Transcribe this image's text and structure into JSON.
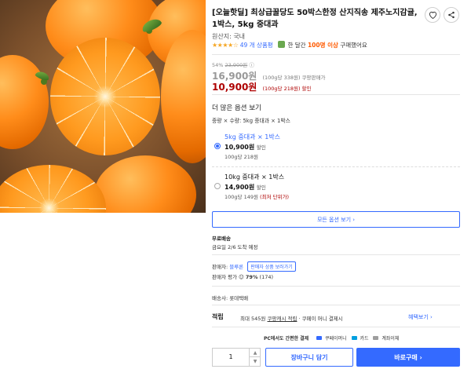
{
  "product": {
    "title": "[오늘핫딜] 최상급꿀당도 50박스한정 산지직송 제주노지감귤, 1박스, 5kg 중대과",
    "origin": "원산지: 국내",
    "rating": {
      "stars": "★★★★☆",
      "review_count": "49 개 상품평",
      "recent_text_prefix": "한 달간",
      "recent_highlight": "100명 이상",
      "recent_text_suffix": "구매했어요"
    }
  },
  "pricing": {
    "discount_rate": "54%",
    "original_price": "23,900원",
    "coupang_price": "16,900원",
    "coupang_unit": "(100g당 338원) 쿠팡판매가",
    "sale_price": "10,900원",
    "sale_unit": "(100g당 218원) 할인"
  },
  "options": {
    "heading": "더 많은 옵션 보기",
    "selected_text": "중량 × 수량: 5kg 중대과 × 1박스",
    "items": [
      {
        "name": "5kg 중대과 × 1박스",
        "price": "10,900원",
        "price_suffix": "할인",
        "unit": "100g당 218원",
        "unit_extra": "",
        "selected": true
      },
      {
        "name": "10kg 중대과 × 1박스",
        "price": "14,900원",
        "price_suffix": "할인",
        "unit": "100g당 149원",
        "unit_extra": "(최저 단위가)",
        "selected": false
      }
    ],
    "all_button": "모든 옵션 보기 ›"
  },
  "shipping": {
    "label": "무료배송",
    "date": "금요일 2/6 도착 예정",
    "company": "배송사: 롯데택배"
  },
  "seller": {
    "label": "판매자:",
    "name": "블루론",
    "more_button": "판매자 상품 보러가기",
    "eval_label": "판매자 평가",
    "eval_percent": "79%",
    "eval_count": "(174)"
  },
  "benefits": {
    "label": "적립",
    "text_prefix": "최대 545원",
    "text_link": "쿠팡캐시 적립",
    "text_suffix": "· 쿠페이 머니 결제시",
    "more": "혜택보기 ›"
  },
  "payment": {
    "heading": "PC에서도 간편한 결제",
    "methods": [
      "쿠페이머니",
      "카드",
      "계좌이체"
    ],
    "colors": [
      "#346aff",
      "#00a0e0",
      "#9e9e9e"
    ]
  },
  "purchase": {
    "quantity": "1",
    "quantity_up": "▲",
    "quantity_down": "▼",
    "cart_button": "장바구니 담기",
    "buy_button": "바로구매 ›"
  },
  "icons": {
    "heart": "heart-icon",
    "share": "share-icon",
    "info": "ⓘ"
  },
  "colors": {
    "accent": "#346aff",
    "sale": "#ae0000",
    "highlight": "#ff5a00",
    "star": "#f5a623"
  }
}
